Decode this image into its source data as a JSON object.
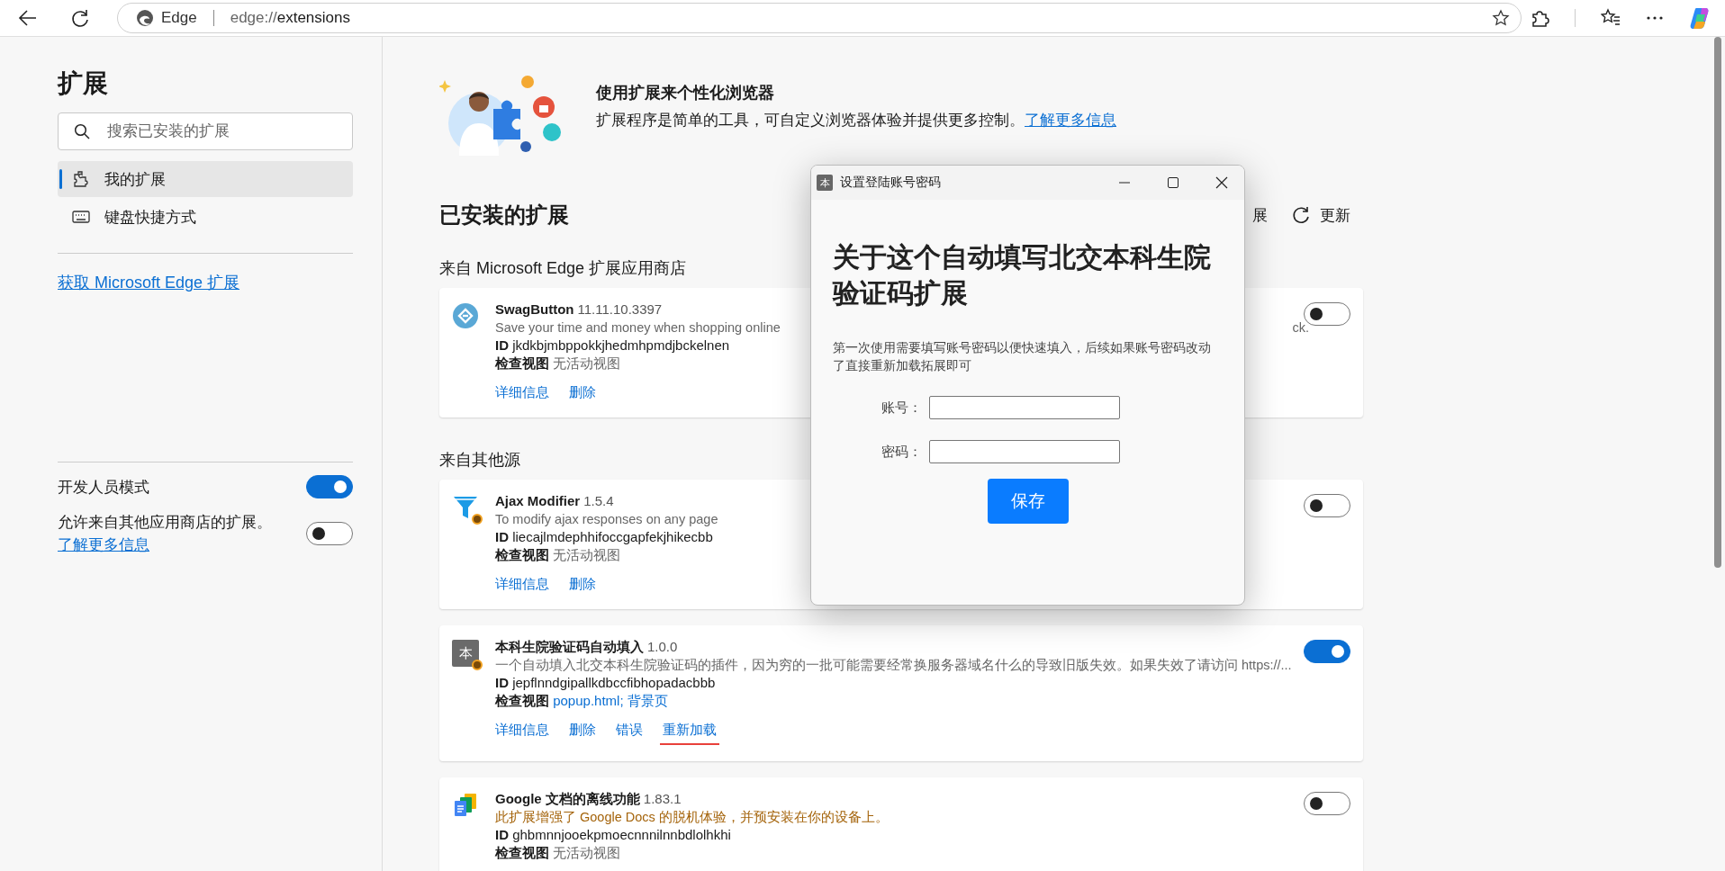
{
  "toolbar": {
    "site_label": "Edge",
    "url_scheme": "edge://",
    "url_path": "extensions"
  },
  "sidebar": {
    "title": "扩展",
    "search": {
      "placeholder": "搜索已安装的扩展"
    },
    "items": [
      {
        "label": "我的扩展",
        "selected": true,
        "kind": "puzzle"
      },
      {
        "label": "键盘快捷方式",
        "selected": false,
        "kind": "keyboard"
      }
    ],
    "store_link": "获取 Microsoft Edge 扩展",
    "settings": [
      {
        "label": "开发人员模式",
        "on": true
      },
      {
        "label": "允许来自其他应用商店的扩展。",
        "link": "了解更多信息",
        "on": false
      }
    ]
  },
  "hero": {
    "title": "使用扩展来个性化浏览器",
    "text": "扩展程序是简单的工具，可自定义浏览器体验并提供更多控制。",
    "link": "了解更多信息"
  },
  "installed": {
    "title": "已安装的扩展",
    "action_fragment": "展",
    "refresh": "更新"
  },
  "sections": [
    {
      "title": "来自 Microsoft Edge 扩展应用商店",
      "extensions": [
        {
          "kind": "store",
          "badge": false,
          "name": "SwagButton",
          "version": "11.11.10.3397",
          "description": "Save your time and money when shopping online",
          "description_tail": "ck.",
          "warning": false,
          "id_label": "ID",
          "id": "jkdkbjmbppokkjhedmhpmdjbckelnen",
          "inspect_label": "检查视图",
          "views": "无活动视图",
          "views_linked": false,
          "links": [
            {
              "label": "详细信息",
              "highlighted": false
            },
            {
              "label": "删除",
              "highlighted": false
            }
          ],
          "on": false
        }
      ]
    },
    {
      "title": "来自其他源",
      "extensions": [
        {
          "kind": "funnel",
          "badge": true,
          "name": "Ajax Modifier",
          "version": "1.5.4",
          "description": "To modify ajax responses on any page",
          "warning": false,
          "id_label": "ID",
          "id": "liecajlmdephhifoccgapfekjhikecbb",
          "inspect_label": "检查视图",
          "views": "无活动视图",
          "views_linked": false,
          "links": [
            {
              "label": "详细信息",
              "highlighted": false
            },
            {
              "label": "删除",
              "highlighted": false
            }
          ],
          "on": false
        },
        {
          "kind": "letter",
          "icon_text": "本",
          "badge": true,
          "name": "本科生院验证码自动填入",
          "version": "1.0.0",
          "description": "一个自动填入北交本科生院验证码的插件，因为穷的一批可能需要经常换服务器域名什么的导致旧版失效。如果失效了请访问 https://...",
          "warning": false,
          "id_label": "ID",
          "id": "jepflnndgipallkdbccfibhopadacbbb",
          "inspect_label": "检查视图",
          "views": "popup.html; 背景页",
          "views_linked": true,
          "links": [
            {
              "label": "详细信息",
              "highlighted": false
            },
            {
              "label": "删除",
              "highlighted": false
            },
            {
              "label": "错误",
              "highlighted": false
            },
            {
              "label": "重新加载",
              "highlighted": true
            }
          ],
          "on": true
        },
        {
          "kind": "docs",
          "badge": false,
          "name": "Google 文档的离线功能",
          "version": "1.83.1",
          "description": "此扩展增强了 Google Docs 的脱机体验，并预安装在你的设备上。",
          "warning": true,
          "id_label": "ID",
          "id": "ghbmnnjooekpmoecnnnilnnbdlolhkhi",
          "inspect_label": "检查视图",
          "views": "无活动视图",
          "views_linked": false,
          "on": false
        }
      ]
    }
  ],
  "dialog": {
    "icon_text": "本",
    "title": "设置登陆账号密码",
    "heading": "关于这个自动填写北交本科生院验证码扩展",
    "text": "第一次使用需要填写账号密码以便快速填入，后续如果账号密码改动了直接重新加载拓展即可",
    "fields": [
      {
        "label": "账号："
      },
      {
        "label": "密码："
      }
    ],
    "button": "保存"
  }
}
